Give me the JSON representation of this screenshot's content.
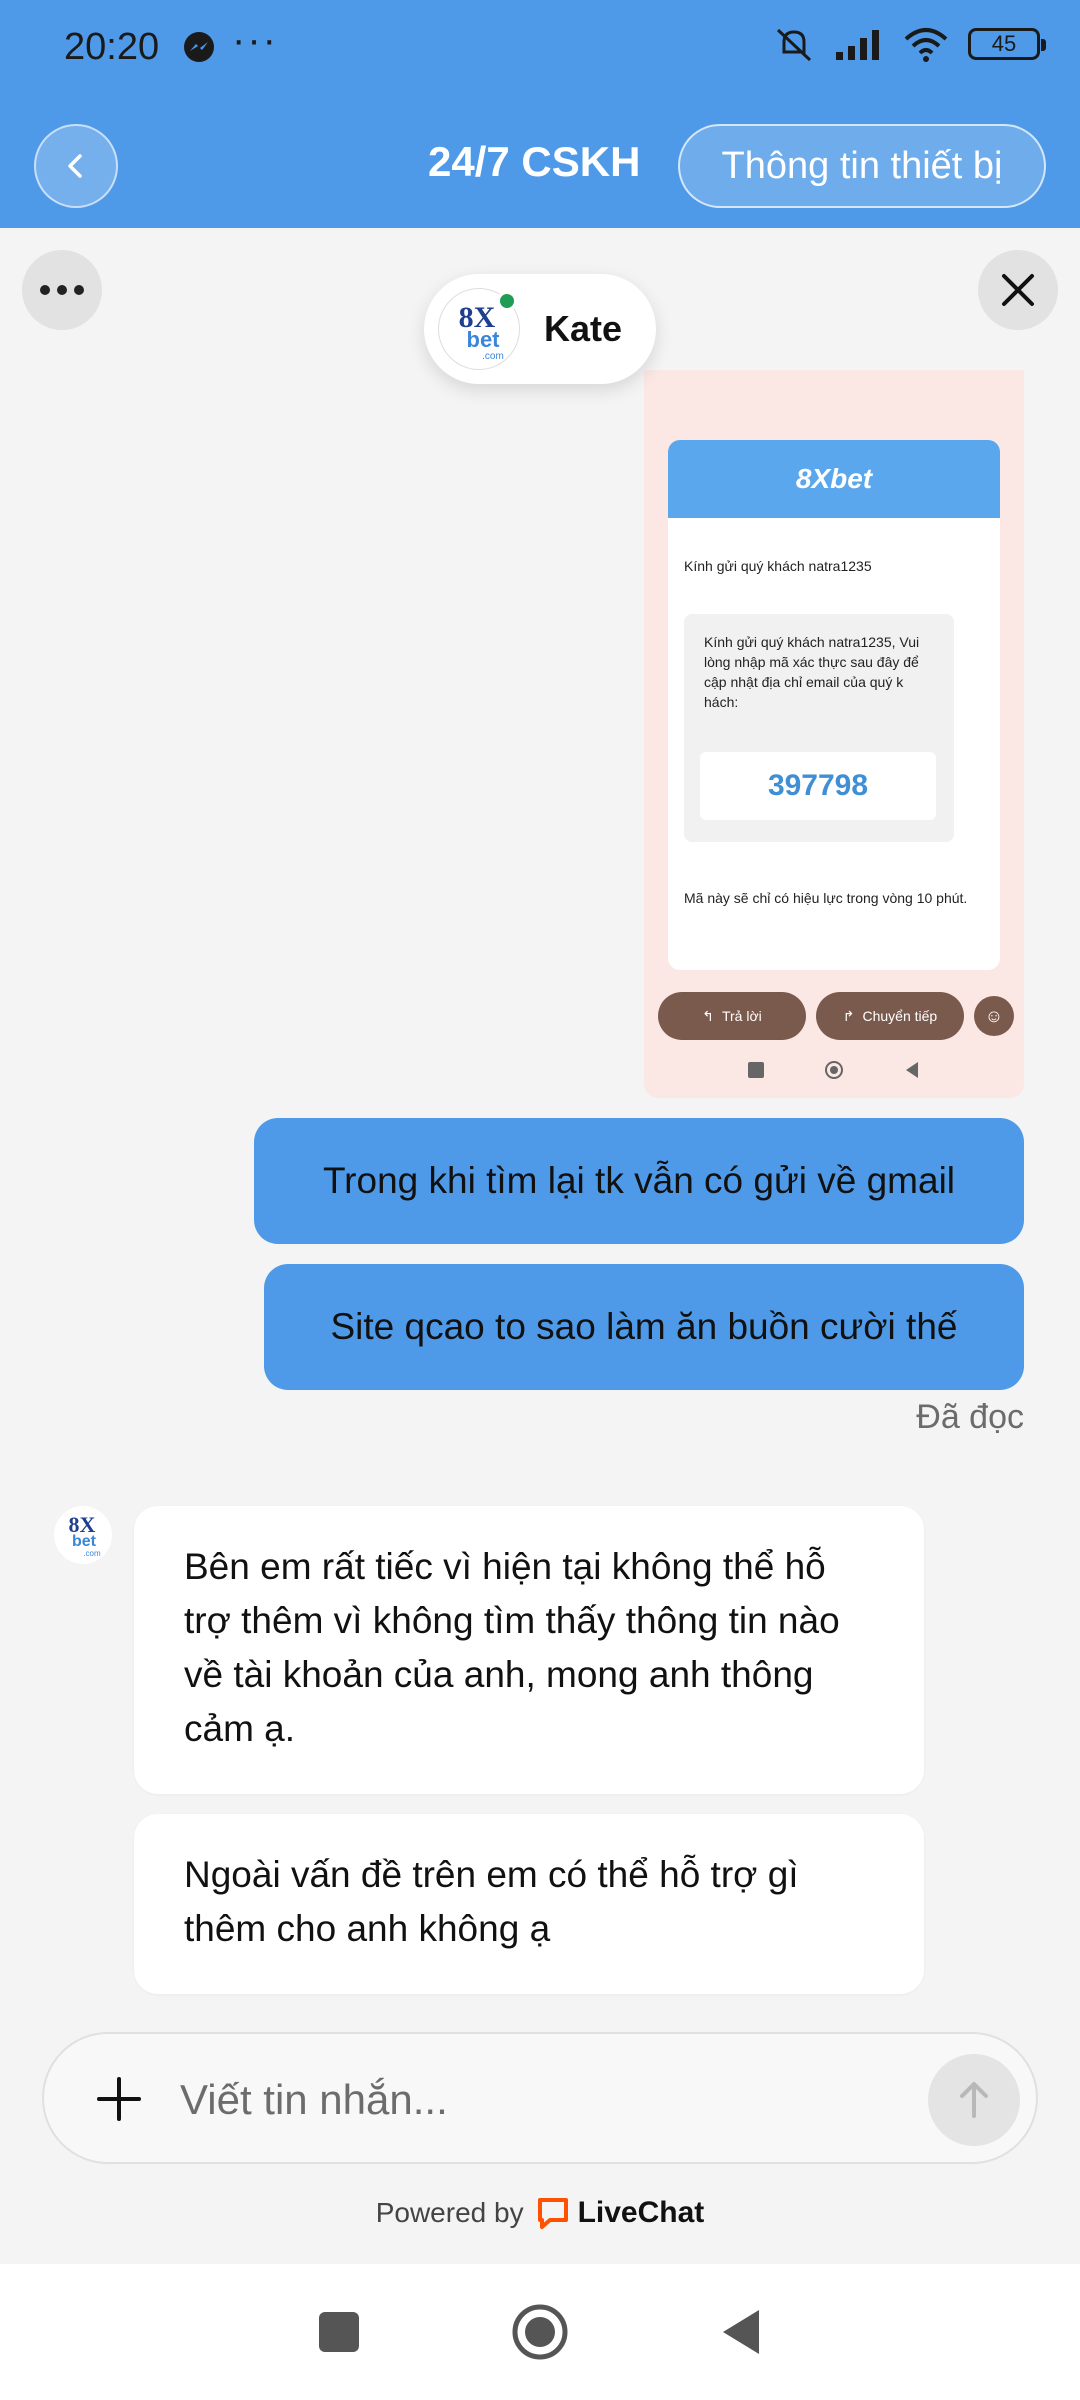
{
  "status_bar": {
    "time": "20:20",
    "more": "···",
    "battery": "45",
    "icons": [
      "messenger-icon",
      "mute-icon",
      "signal-icon",
      "wifi-icon",
      "battery-icon"
    ]
  },
  "header": {
    "title": "24/7 CSKH",
    "device_button": "Thông tin thiết bị"
  },
  "agent": {
    "name": "Kate",
    "logo_line1": "8X",
    "logo_line2": "bet",
    "logo_line3": ".com"
  },
  "attachment": {
    "brand": "8Xbet",
    "greeting": "Kính gửi quý khách natra1235",
    "box_text": "Kính gửi quý khách natra1235, Vui lòng nhập mã xác thực sau đây để cập nhật địa chỉ email của quý k hách:",
    "code": "397798",
    "note": "Mã này sẽ chỉ có hiệu lực trong vòng 10 phút.",
    "reply_label": "Trả lời",
    "forward_label": "Chuyển tiếp"
  },
  "messages": {
    "outgoing": [
      "Trong khi tìm lại tk vẫn có gửi về gmail",
      "Site qcao to sao làm ăn buồn cười thế"
    ],
    "read_status": "Đã đọc",
    "incoming": [
      "Bên em rất tiếc vì hiện tại không thể hỗ trợ thêm vì không tìm thấy thông tin nào về tài khoản của anh, mong anh thông cảm ạ.",
      "Ngoài vấn đề trên em có thể hỗ trợ gì thêm cho anh không ạ"
    ]
  },
  "composer": {
    "placeholder": "Viết tin nhắn..."
  },
  "footer": {
    "powered_by": "Powered by",
    "brand": "LiveChat"
  },
  "colors": {
    "header_blue": "#4f9ae8",
    "bubble_out": "#4f9ae8",
    "livechat_orange": "#ff5100"
  }
}
